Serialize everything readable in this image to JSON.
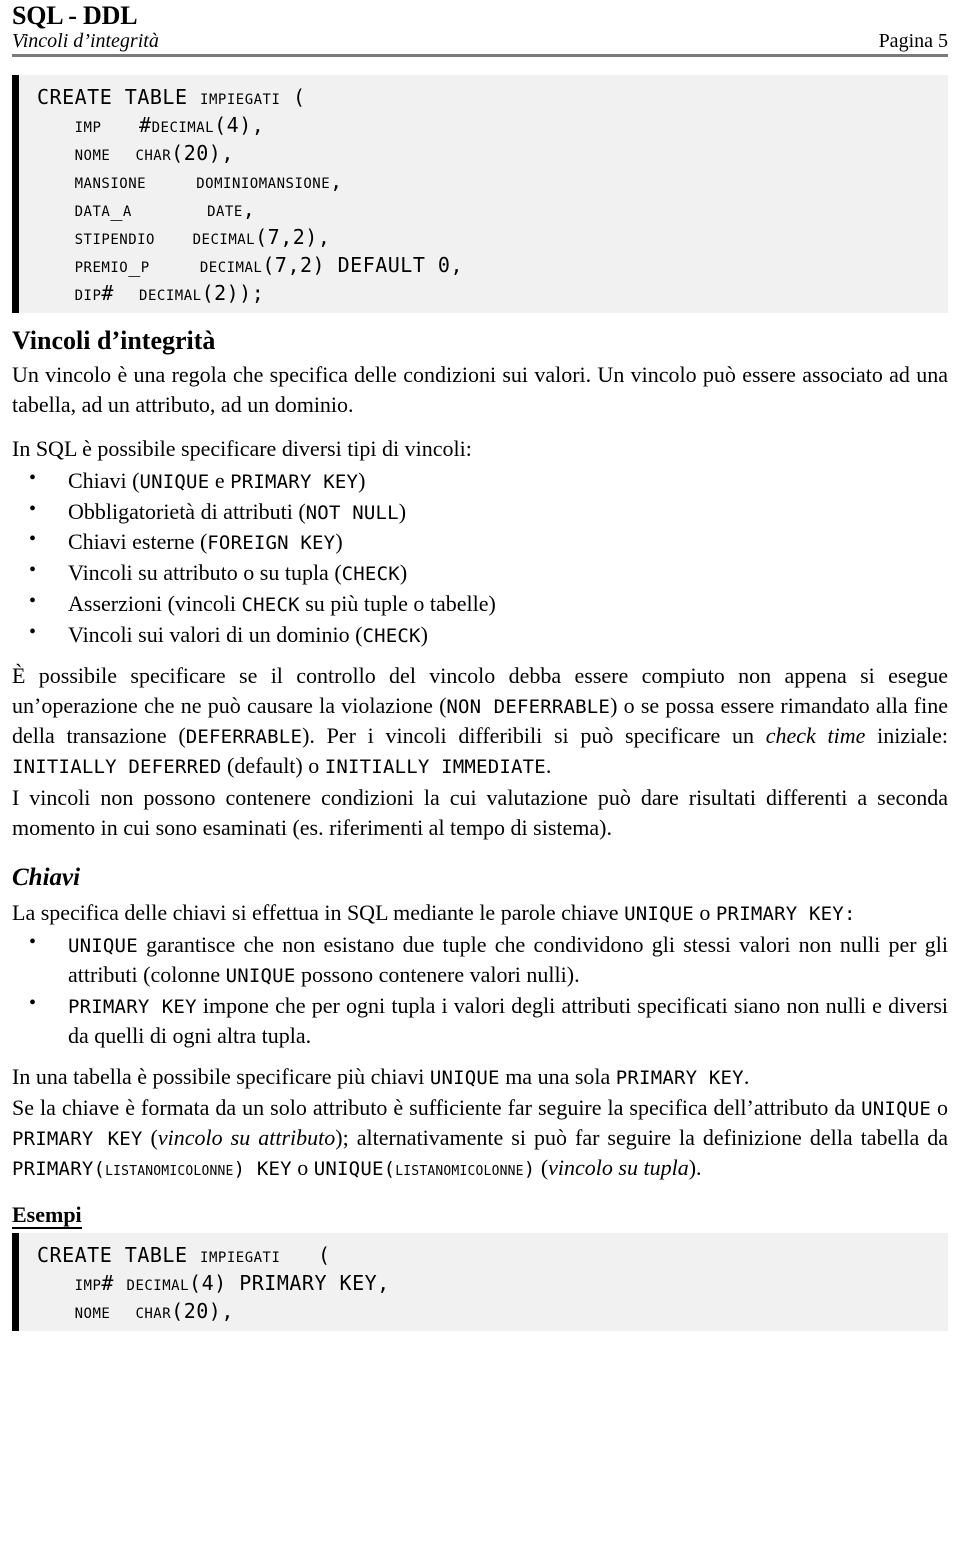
{
  "header": {
    "title": "SQL - DDL",
    "subtitle": "Vincoli d’integrità",
    "page_label": "Pagina 5"
  },
  "code_block_top": "CREATE TABLE IMPIEGATI (\n   IMP   #DECIMAL(4),\n   NOME  CHAR(20),\n   MANSIONE    DOMINIOMANSIONE,\n   DATA_A      DATE,\n   STIPENDIO   DECIMAL(7,2),\n   PREMIO_P    DECIMAL(7,2) DEFAULT 0,\n   DIP#  DECIMAL(2));",
  "code_block_top_lines": [
    {
      "plain1": "CREATE TABLE ",
      "sc1": "Impiegati",
      "plain2": " ("
    },
    {
      "plain1": "   ",
      "sc1": "Imp",
      "plain2": "   #",
      "sc2": "Decimal",
      "plain3": "(4),"
    },
    {
      "plain1": "   ",
      "sc1": "Nome",
      "plain2": "  ",
      "sc2": "Char",
      "plain3": "(20),"
    },
    {
      "plain1": "   ",
      "sc1": "Mansione",
      "plain2": "    ",
      "sc2": "DominioMansione",
      "plain3": ","
    },
    {
      "plain1": "   ",
      "sc1": "Data_A",
      "plain2": "      ",
      "sc2": "Date",
      "plain3": ","
    },
    {
      "plain1": "   ",
      "sc1": "Stipendio",
      "plain2": "   ",
      "sc2": "Decimal",
      "plain3": "(7,2),"
    },
    {
      "plain1": "   ",
      "sc1": "Premio_P",
      "plain2": "    ",
      "sc2": "Decimal",
      "plain3": "(7,2) DEFAULT 0,"
    },
    {
      "plain1": "   ",
      "sc1": "Dip",
      "plain2": "#  ",
      "sc2": "Decimal",
      "plain3": "(2));"
    }
  ],
  "section_vincoli": {
    "heading": "Vincoli d’integrità",
    "intro_para": "Un vincolo è una regola che specifica delle condizioni sui valori. Un vincolo può essere associato ad una tabella, ad un attributo, ad un dominio.",
    "list_intro": "In SQL è possibile specificare diversi tipi di vincoli:",
    "bullet": "•",
    "items": [
      {
        "pre": "Chiavi (",
        "kw1": "UNIQUE",
        "mid": " e ",
        "kw2": "PRIMARY KEY",
        "post": ")"
      },
      {
        "pre": "Obbligatorietà di attributi (",
        "kw1": "NOT NULL",
        "mid": "",
        "kw2": "",
        "post": ")"
      },
      {
        "pre": "Chiavi esterne (",
        "kw1": "FOREIGN KEY",
        "mid": "",
        "kw2": "",
        "post": ")"
      },
      {
        "pre": "Vincoli su attributo o su tupla (",
        "kw1": "CHECK",
        "mid": "",
        "kw2": "",
        "post": ")"
      },
      {
        "pre": "Asserzioni (vincoli ",
        "kw1": "CHECK",
        "mid": " su più tuple o tabelle",
        "kw2": "",
        "post": ")"
      },
      {
        "pre": "Vincoli sui valori di un dominio (",
        "kw1": "CHECK",
        "mid": "",
        "kw2": "",
        "post": ")"
      }
    ],
    "deferrable_para": {
      "t1": "È possibile specificare se il controllo del vincolo debba essere compiuto non appena si esegue un’operazione che ne può causare la violazione (",
      "kw1": "NON DEFERRABLE",
      "t2": ") o se possa essere rimandato alla fine della transazione (",
      "kw2": "DEFERRABLE",
      "t3": "). Per i vincoli differibili si può specificare un ",
      "ital1": "check time",
      "t4": " iniziale: ",
      "kw3": "INITIALLY DEFERRED",
      "t5": " (default) o ",
      "kw4": "INITIALLY IMMEDIATE",
      "t6": "."
    },
    "no_dynamic_para": "I vincoli non possono contenere condizioni la cui valutazione può dare risultati differenti a seconda momento in cui sono esaminati (es. riferimenti al tempo di sistema)."
  },
  "section_chiavi": {
    "heading": "Chiavi",
    "intro": {
      "t1": "La specifica delle chiavi si effettua in SQL mediante le parole chiave ",
      "kw1": "UNIQUE",
      "t2": " o ",
      "kw2": "PRIMARY KEY",
      "t3": ":"
    },
    "bullet": "•",
    "items": [
      {
        "kw1": "UNIQUE",
        "t1": " garantisce che non esistano due tuple che condividono gli stessi valori non nulli per gli attributi (colonne ",
        "kw2": "UNIQUE",
        "t2": " possono contenere valori nulli)."
      },
      {
        "kw1": "PRIMARY KEY",
        "t1": " impone che per ogni tupla i valori degli attributi specificati siano non nulli e diversi da quelli di ogni altra tupla.",
        "kw2": "",
        "t2": ""
      }
    ],
    "multi_key_para": {
      "t1": "In una tabella è possibile specificare più chiavi ",
      "kw1": "UNIQUE",
      "t2": " ma una sola ",
      "kw2": "PRIMARY KEY",
      "t3": "."
    },
    "single_attr_para": {
      "t1": "Se la chiave è formata da un solo attributo è sufficiente far seguire la specifica dell’attributo da ",
      "kw1": "UNIQUE",
      "t2": " o ",
      "kw2": "PRIMARY KEY",
      "t3": " (",
      "ital1": "vincolo su attributo",
      "t4": "); alternativamente si può far seguire la definizione della tabella da ",
      "kw3": "PRIMARY(",
      "kwsc1": "ListaNomiColonne",
      "kw4": ") KEY",
      "t5": " o ",
      "kw5": "UNIQUE(",
      "kwsc2": "ListaNomiColonne",
      "kw6": ")",
      "t6": " (",
      "ital2": "vincolo su tupla",
      "t7": ")."
    }
  },
  "section_esempi": {
    "heading": "Esempi",
    "code_lines": [
      {
        "plain1": "CREATE TABLE ",
        "sc1": "Impiegati",
        "plain2": "   ("
      },
      {
        "plain1": "   ",
        "sc1": "Imp",
        "plain2": "# ",
        "sc2": "Decimal",
        "plain3": "(4) PRIMARY KEY,"
      },
      {
        "plain1": "   ",
        "sc1": "Nome",
        "plain2": "  ",
        "sc2": "Char",
        "plain3": "(20),"
      }
    ]
  },
  "colors": {
    "text": "#000000",
    "rule": "#7b7b7b",
    "code_bg": "#f1f1f1",
    "code_bar": "#000000"
  }
}
